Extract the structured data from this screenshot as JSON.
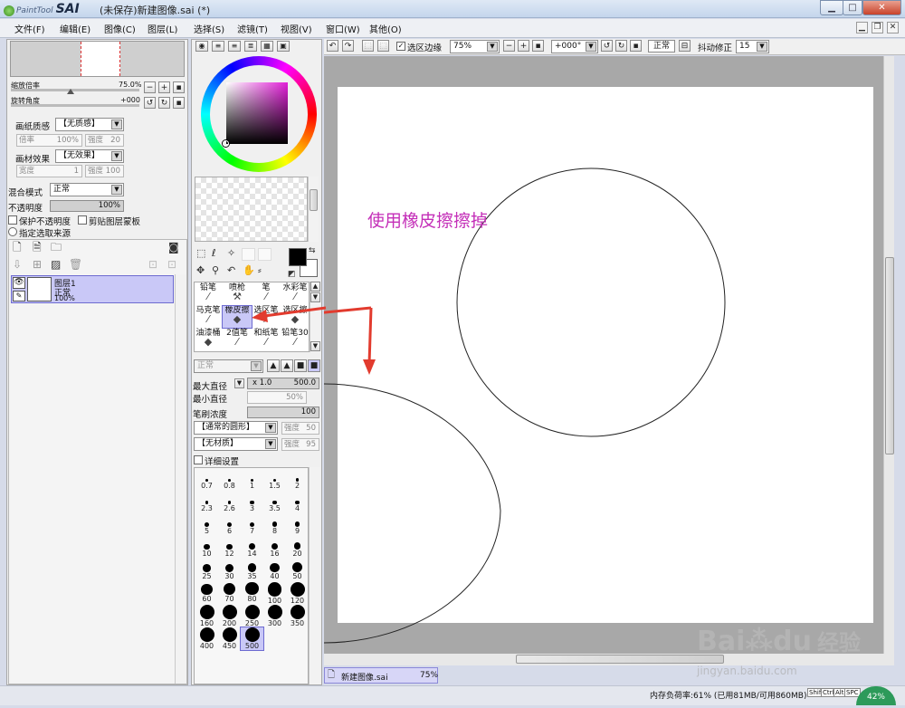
{
  "window": {
    "app_logo": "PaintTool",
    "app_name": "SAI",
    "title": "(未保存)新建图像.sai (*)",
    "minimize": "▁",
    "maximize": "□",
    "close": "✕"
  },
  "menu": [
    "文件(F)",
    "编辑(E)",
    "图像(C)",
    "图层(L)",
    "选择(S)",
    "滤镜(T)",
    "视图(V)",
    "窗口(W)",
    "其他(O)"
  ],
  "mdi": {
    "minimize": "▁",
    "restore": "❐",
    "close": "✕"
  },
  "toolbar": {
    "selection_edge": "选区边缘",
    "zoom": "75%",
    "rotation": "+000°",
    "blend": "正常",
    "stabilizer_label": "抖动修正",
    "stabilizer": "15"
  },
  "navigator": {
    "zoom_label": "缩放倍率",
    "zoom_value": "75.0%",
    "rotate_label": "旋转角度",
    "rotate_value": "+000"
  },
  "paper": {
    "texture_label": "画纸质感",
    "texture_value": "【无质感】",
    "scale_label": "倍率",
    "scale_value": "100%",
    "strength_label": "强度",
    "strength_value": "20",
    "effect_label": "画材效果",
    "effect_value": "【无效果】",
    "width_label": "宽度",
    "width_value": "1",
    "intensity_label": "强度",
    "intensity_value": "100"
  },
  "layer_props": {
    "blend_label": "混合模式",
    "blend_value": "正常",
    "opacity_label": "不透明度",
    "opacity_value": "100%",
    "preserve_opacity": "保护不透明度",
    "clipping": "剪贴图层蒙板",
    "selection_source": "指定选取来源"
  },
  "layer": {
    "name": "图层1",
    "mode": "正常",
    "opacity": "100%"
  },
  "tools": {
    "row1": [
      "铅笔",
      "喷枪",
      "笔",
      "水彩笔"
    ],
    "row2": [
      "马克笔",
      "橡皮擦",
      "选区笔",
      "选区擦"
    ],
    "row3": [
      "油漆桶",
      "2值笔",
      "和纸笔",
      "铅笔30"
    ]
  },
  "brush": {
    "mode": "正常",
    "max_size_label": "最大直径",
    "max_size_mult": "x 1.0",
    "max_size_value": "500.0",
    "min_size_label": "最小直径",
    "min_size_value": "50%",
    "density_label": "笔刷浓度",
    "density_value": "100",
    "shape": "【通常的圆形】",
    "shape_strength_label": "强度",
    "shape_strength": "50",
    "texture": "【无材质】",
    "texture_strength_label": "强度",
    "texture_strength": "95",
    "details_label": "详细设置"
  },
  "brush_sizes": [
    "0.7",
    "0.8",
    "1",
    "1.5",
    "2",
    "2.3",
    "2.6",
    "3",
    "3.5",
    "4",
    "5",
    "6",
    "7",
    "8",
    "9",
    "10",
    "12",
    "14",
    "16",
    "20",
    "25",
    "30",
    "35",
    "40",
    "50",
    "60",
    "70",
    "80",
    "100",
    "120",
    "160",
    "200",
    "250",
    "300",
    "350",
    "400",
    "450",
    "500"
  ],
  "canvas": {
    "annotation": "使用橡皮擦擦掉"
  },
  "doc_tab": {
    "name": "新建图像.sai",
    "zoom": "75%"
  },
  "status": {
    "memory": "内存负荷率:61% (已用81MB/可用860MB)",
    "keys": [
      "Shift",
      "Ctrl",
      "Alt",
      "SPC"
    ],
    "badge": "42%"
  },
  "watermark": {
    "brand": "Bai",
    "brand2": "du",
    "cn": "经验",
    "url": "jingyan.baidu.com"
  },
  "colors": {
    "annotation": "#c42fb8",
    "arrow": "#e23b2e",
    "selected": "#c9c8f7"
  }
}
